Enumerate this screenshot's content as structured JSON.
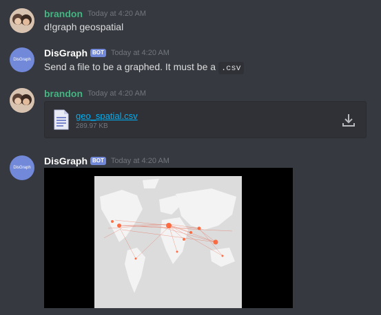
{
  "messages": {
    "m1": {
      "author": "brandon",
      "time": "Today at 4:20 AM",
      "text": "d!graph geospatial"
    },
    "m2": {
      "author": "DisGraph",
      "badge": "BOT",
      "time": "Today at 4:20 AM",
      "text_before": "Send a file to be a graphed. It must be a ",
      "code": ".csv",
      "avatar_label": "DisGraph"
    },
    "m3": {
      "author": "brandon",
      "time": "Today at 4:20 AM",
      "file": {
        "name": "geo_spatial.csv",
        "size": "289.97 KB"
      }
    },
    "m4": {
      "author": "DisGraph",
      "badge": "BOT",
      "time": "Today at 4:20 AM",
      "avatar_label": "DisGraph"
    }
  },
  "colors": {
    "user_name": "#43b581",
    "bot_badge": "#7289da",
    "link": "#00b0f4",
    "background": "#36393f"
  }
}
